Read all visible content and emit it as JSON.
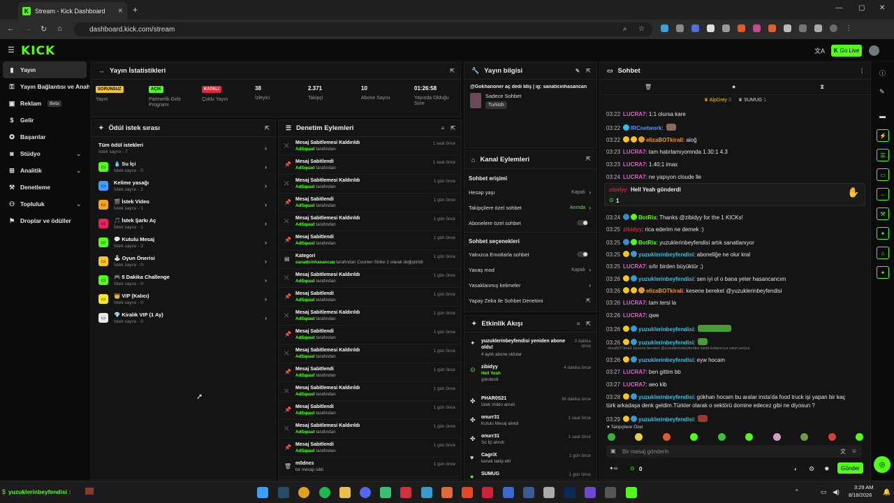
{
  "browser": {
    "tab_title": "Stream - Kick Dashboard",
    "url": "dashboard.kick.com/stream"
  },
  "header": {
    "logo": "KICK",
    "go_live": "Go Live"
  },
  "sidebar": {
    "items": [
      {
        "label": "Yayın"
      },
      {
        "label": "Yayın Bağlantısı ve Anahtarı"
      },
      {
        "label": "Reklam",
        "badge": "Beta"
      },
      {
        "label": "Gelir"
      },
      {
        "label": "Başarılar"
      },
      {
        "label": "Stüdyo"
      },
      {
        "label": "Analitik"
      },
      {
        "label": "Denetleme"
      },
      {
        "label": "Topluluk"
      },
      {
        "label": "Droplar ve ödüller"
      }
    ]
  },
  "stats": {
    "title": "Yayın İstatistikleri",
    "items": [
      {
        "value": "SORUNSUZ",
        "label": "Yayın",
        "color": "#f7c51f"
      },
      {
        "value": "AÇIK",
        "label": "Partnerlik Gelir Programı",
        "color": "#53fc18"
      },
      {
        "value": "KAPALI",
        "label": "Çoklu Yayın",
        "color": "#e0263a"
      },
      {
        "value": "38",
        "label": "İzleyici"
      },
      {
        "value": "2.371",
        "label": "Takipçi"
      },
      {
        "value": "10",
        "label": "Abone Sayısı"
      },
      {
        "value": "01:26:58",
        "label": "Yayında Olduğu Süre"
      }
    ]
  },
  "rewards": {
    "title": "Ödül istek sırası",
    "items": [
      {
        "name": "Tüm ödül istekleri",
        "count": "İstek sayısı - 7"
      },
      {
        "name": "💧 Su İçi",
        "count": "İstek sayısı - 0"
      },
      {
        "name": "Kelime yasağı",
        "count": "İstek sayısı - 2"
      },
      {
        "name": "🎬 İstek Video",
        "count": "İstek sayısı - 1"
      },
      {
        "name": "🎵 İstek Şarkı Aç",
        "count": "İstek sayısı - 1"
      },
      {
        "name": "💬 Kutulu Mesaj",
        "count": "İstek sayısı - 2"
      },
      {
        "name": "🕹 Oyun Önerisi",
        "count": "İstek sayısı - 0"
      },
      {
        "name": "🎮 5 Dakika Challenge",
        "count": "İstek sayısı - 0"
      },
      {
        "name": "👑 VIP (Kalıcı)",
        "count": "İstek sayısı - 0"
      },
      {
        "name": "💎 Kiralık VIP (1 Ay)",
        "count": "İstek sayısı - 0"
      }
    ]
  },
  "moderation": {
    "title": "Denetim Eylemleri",
    "items": [
      {
        "action": "Mesaj Sabitlemesi Kaldırıldı",
        "by": "AdSquad",
        "suffix": "tarafından",
        "time": "1 saat önce",
        "icon": "unpin"
      },
      {
        "action": "Mesaj Sabitlendi",
        "by": "AdSquad",
        "suffix": "tarafından",
        "time": "1 saat önce",
        "icon": "pin"
      },
      {
        "action": "Mesaj Sabitlemesi Kaldırıldı",
        "by": "AdSquad",
        "suffix": "tarafından",
        "time": "1 gün önce",
        "icon": "unpin"
      },
      {
        "action": "Mesaj Sabitlendi",
        "by": "AdSquad",
        "suffix": "tarafından",
        "time": "1 gün önce",
        "icon": "pin"
      },
      {
        "action": "Mesaj Sabitlemesi Kaldırıldı",
        "by": "AdSquad",
        "suffix": "tarafından",
        "time": "1 gün önce",
        "icon": "unpin"
      },
      {
        "action": "Mesaj Sabitlendi",
        "by": "AdSquad",
        "suffix": "tarafından",
        "time": "1 gün önce",
        "icon": "pin"
      },
      {
        "action": "Kategori",
        "by": "sanaticinhasancan",
        "suffix": "tarafından Counter-Strike 2 olarak değiştirildi",
        "time": "1 gün önce",
        "icon": "category"
      },
      {
        "action": "Mesaj Sabitlemesi Kaldırıldı",
        "by": "AdSquad",
        "suffix": "tarafından",
        "time": "1 gün önce",
        "icon": "unpin"
      },
      {
        "action": "Mesaj Sabitlendi",
        "by": "AdSquad",
        "suffix": "tarafından",
        "time": "1 gün önce",
        "icon": "pin"
      },
      {
        "action": "Mesaj Sabitlemesi Kaldırıldı",
        "by": "AdSquad",
        "suffix": "tarafından",
        "time": "1 gün önce",
        "icon": "unpin"
      },
      {
        "action": "Mesaj Sabitlendi",
        "by": "AdSquad",
        "suffix": "tarafından",
        "time": "1 gün önce",
        "icon": "pin"
      },
      {
        "action": "Mesaj Sabitlemesi Kaldırıldı",
        "by": "AdSquad",
        "suffix": "tarafından",
        "time": "1 gün önce",
        "icon": "unpin"
      },
      {
        "action": "Mesaj Sabitlendi",
        "by": "AdSquad",
        "suffix": "tarafından",
        "time": "1 gün önce",
        "icon": "pin"
      },
      {
        "action": "Mesaj Sabitlemesi Kaldırıldı",
        "by": "AdSquad",
        "suffix": "tarafından",
        "time": "1 gün önce",
        "icon": "unpin"
      },
      {
        "action": "Mesaj Sabitlendi",
        "by": "AdSquad",
        "suffix": "tarafından",
        "time": "1 gün önce",
        "icon": "pin"
      },
      {
        "action": "Mesaj Sabitlemesi Kaldırıldı",
        "by": "AdSquad",
        "suffix": "tarafından",
        "time": "1 gün önce",
        "icon": "unpin"
      },
      {
        "action": "Mesaj Sabitlendi",
        "by": "AdSquad",
        "suffix": "tarafından",
        "time": "1 gün önce",
        "icon": "pin"
      },
      {
        "action": "m0dnes",
        "by": "",
        "suffix": "bir mesajı sildi",
        "time": "1 gün önce",
        "icon": "trash"
      }
    ]
  },
  "stream_info": {
    "title": "Yayın bilgisi",
    "stream_title": "@Gokhanoner aç dedi İdiş | ig: sanaticinhasancan",
    "chat_mode": "Sadece Sohbet",
    "language": "Turkish"
  },
  "channel_actions": {
    "title": "Kanal Eylemleri",
    "section1": "Sohbet erişimi",
    "rows1": [
      {
        "label": "Hesap yaşı",
        "value": "Kapalı"
      },
      {
        "label": "Takipçilere özel sohbet",
        "value": "Anında"
      },
      {
        "label": "Abonelere özel sohbet",
        "value": ""
      }
    ],
    "section2": "Sohbet seçenekleri",
    "rows2": [
      {
        "label": "Yalnızca Emotlarla sohbet",
        "value": ""
      },
      {
        "label": "Yavaş mod",
        "value": "Kapalı"
      },
      {
        "label": "Yasaklanmış kelimeler",
        "value": ""
      },
      {
        "label": "Yapay Zeka ile Sohbet Denetimi",
        "value": ""
      }
    ]
  },
  "activity": {
    "title": "Etkinlik Akışı",
    "items": [
      {
        "line1": "yuzuklerinbeyfendisi yeniden abone oldu!",
        "line2": "4 aylık abone oldular",
        "time": "3 dakika önce"
      },
      {
        "line1": "zibidyy",
        "line2": "Hell Yeah",
        "line3": "gönderdi",
        "time": "4 dakika önce"
      },
      {
        "line1": "PHAR0S21",
        "line2": "İstek Video alındı",
        "time": "36 dakika önce"
      },
      {
        "line1": "onurr31",
        "line2": "Kutulu Mesaj alındı",
        "time": "1 saat önce"
      },
      {
        "line1": "onurr31",
        "line2": "Su İçi alındı",
        "time": "1 saat önce"
      },
      {
        "line1": "CagriX",
        "line2": "kanalı takip etti",
        "time": "1 gün önce"
      },
      {
        "line1": "SUMUG",
        "line2": "",
        "time": "1 gün önce"
      }
    ]
  },
  "chat": {
    "title": "Sohbet",
    "top_users": [
      {
        "name": "AlpGrey",
        "n": "3"
      },
      {
        "name": "SUMUG",
        "n": "1"
      }
    ],
    "messages": [
      {
        "t": "03:22",
        "u": "LUCRA7",
        "c": "#e75ad9",
        "m": ": 1:1 olursa kare"
      },
      {
        "t": "03:22",
        "u": "IRCnetwork",
        "c": "#5b8cff",
        "m": ":"
      },
      {
        "t": "03:22",
        "u": "elizaBOTkirali",
        "c": "#e39a36",
        "m": ": aloğ"
      },
      {
        "t": "03:23",
        "u": "LUCRA7",
        "c": "#e75ad9",
        "m": ": tam hatırlamıyomnda 1.30:1 4.3"
      },
      {
        "t": "03:23",
        "u": "LUCRA7",
        "c": "#e75ad9",
        "m": ": 1.40:1 imax"
      },
      {
        "t": "03:24",
        "u": "LUCRA7",
        "c": "#e75ad9",
        "m": ": ne yapıyon cloude lle"
      },
      {
        "t": "03:24",
        "u": "BotRix",
        "c": "#53fc18",
        "m": ": Thanks @zibidyy for the 1 KICKs!"
      },
      {
        "t": "03:25",
        "u": "zibidyy",
        "c": "#d0253a",
        "m": ": rica ederim ne demek :)"
      },
      {
        "t": "03:25",
        "u": "BotRix",
        "c": "#53fc18",
        "m": ": yuzuklerinbeyfendisi artık sanatlanıyor"
      },
      {
        "t": "03:25",
        "u": "yuzuklerinbeyfendisi",
        "c": "#2ec3e0",
        "m": ": aboneliğe ne olur kral"
      },
      {
        "t": "03:25",
        "u": "LUCRA7",
        "c": "#e75ad9",
        "m": ": sıfır birden büyüktür ;)"
      },
      {
        "t": "03:26",
        "u": "yuzuklerinbeyfendisi",
        "c": "#2ec3e0",
        "m": ": sen iyi ol o bana yeter hasancancım"
      },
      {
        "t": "03:26",
        "u": "elizaBOTkirali",
        "c": "#e39a36",
        "m": ": kesene bereket @yuzuklerinbeyfendisi"
      },
      {
        "t": "03:26",
        "u": "LUCRA7",
        "c": "#e75ad9",
        "m": ": tam tersi la"
      },
      {
        "t": "03:26",
        "u": "LUCRA7",
        "c": "#e75ad9",
        "m": ": qwe"
      },
      {
        "t": "03:26",
        "u": "yuzuklerinbeyfendisi",
        "c": "#2ec3e0",
        "m": ":"
      },
      {
        "t": "03:26",
        "u": "yuzuklerinbeyfendisi",
        "c": "#2ec3e0",
        "m": ":"
      },
      {
        "t": "03:26",
        "u": "yuzuklerinbeyfendisi",
        "c": "#2ec3e0",
        "m": ": eyw hocam"
      },
      {
        "t": "03:27",
        "u": "LUCRA7",
        "c": "#e75ad9",
        "m": ": ben gittim bb"
      },
      {
        "t": "03:27",
        "u": "LUCRA7",
        "c": "#e75ad9",
        "m": ": aeo kib"
      },
      {
        "t": "03:28",
        "u": "yuzuklerinbeyfendisi",
        "c": "#2ec3e0",
        "m": ": gökhan hocam bu aralar insta'da food truck işi yapan bir kaç"
      },
      {
        "t": "",
        "u": "",
        "c": "#fff",
        "m": "türk arkadaşa denk geldim.Türkler olarak o sektörü domine edecez gibi ne diyosun ?"
      },
      {
        "t": "03:29",
        "u": "yuzuklerinbeyfendisi",
        "c": "#2ec3e0",
        "m": ":"
      }
    ],
    "pinned": {
      "user": "zibidyy",
      "text": "Hell Yeah gönderdi",
      "count": "1"
    },
    "reply_note": "elizaBOTkirali: kesene bereket @yuzuklerinbeyfendisi isimli kullanıcıya yanıt veriyor",
    "followers_only": "Takipçilere Özel",
    "input_placeholder": "Bir mesaj gönderin",
    "send": "Gönder",
    "viewer_count": "0"
  },
  "taskbar": {
    "ticker_user": "yuzuklerinbeyfendisi :",
    "time": "3:29 AM",
    "date": "8/18/2026"
  }
}
